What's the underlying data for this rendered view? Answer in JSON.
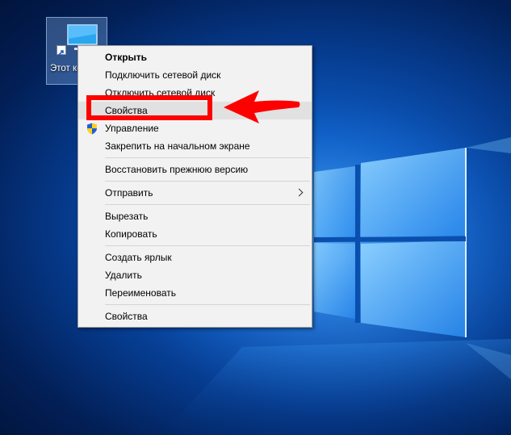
{
  "desktop": {
    "icon_label": "Этот компьютер",
    "icon": "computer-icon"
  },
  "context_menu": {
    "items": [
      {
        "label": "Открыть",
        "bold": true
      },
      {
        "label": "Подключить сетевой диск"
      },
      {
        "label": "Отключить сетевой диск"
      },
      {
        "label": "Свойства",
        "hovered": true
      },
      {
        "label": "Управление",
        "icon": "shield-icon"
      },
      {
        "label": "Закрепить на начальном экране"
      },
      {
        "label": "Восстановить прежнюю версию"
      },
      {
        "label": "Отправить",
        "submenu": true
      },
      {
        "label": "Вырезать"
      },
      {
        "label": "Копировать"
      },
      {
        "label": "Создать ярлык"
      },
      {
        "label": "Удалить"
      },
      {
        "label": "Переименовать"
      },
      {
        "label": "Свойства"
      }
    ]
  },
  "annotation": {
    "box_color": "#ff0000",
    "arrow_color": "#ff0000",
    "arrow_icon": "left-arrow-icon"
  },
  "colors": {
    "menu_background": "#f2f2f2",
    "hover": "#e1e1e1",
    "wallpaper_blue": "#0d5cc4"
  }
}
